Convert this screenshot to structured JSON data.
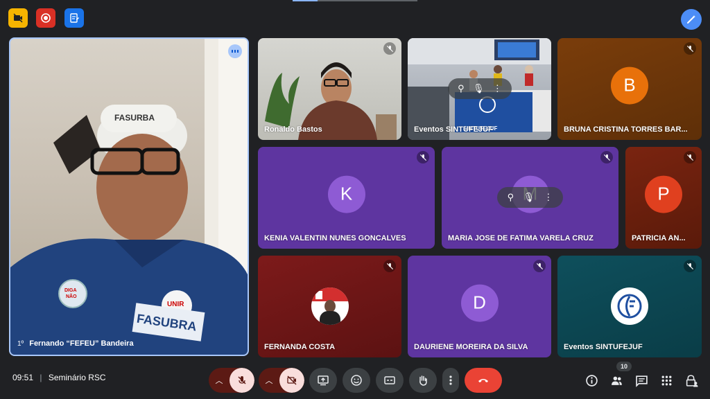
{
  "top": {
    "icons": [
      "no-camera-badge",
      "recording-icon",
      "notes-icon",
      "magic-wand-icon"
    ]
  },
  "colors": {
    "background": "#202124",
    "accent": "#8ab4f8",
    "danger": "#ea4335",
    "purple_tile": "#5e35a0"
  },
  "presenter": {
    "name": "Fernando “FEFEU” Bandeira",
    "pin_label": "1º"
  },
  "tiles": [
    {
      "name": "Ronaldo Bastos"
    },
    {
      "name": "Eventos SINTUFEJUF"
    },
    {
      "name": "BRUNA CRISTINA TORRES BAR...",
      "initial": "B",
      "color": "#e8710a"
    },
    {
      "name": "KENIA VALENTIN NUNES GONCALVES",
      "initial": "K",
      "color": "#8e5bd4"
    },
    {
      "name": "MARIA JOSE DE FATIMA VARELA CRUZ",
      "initial": "M",
      "color": "#8e5bd4"
    },
    {
      "name": "PATRICIA AN...",
      "initial": "P",
      "color": "#e0401f"
    },
    {
      "name": "FERNANDA COSTA"
    },
    {
      "name": "DAURIENE MOREIRA DA SILVA",
      "initial": "D",
      "color": "#8e5bd4"
    },
    {
      "name": "Eventos SINTUFEJUF"
    }
  ],
  "stage_text": "SINTUFEJUF",
  "bottom": {
    "time": "09:51",
    "separator": "|",
    "meeting": "Seminário RSC",
    "participants_count": "10"
  }
}
